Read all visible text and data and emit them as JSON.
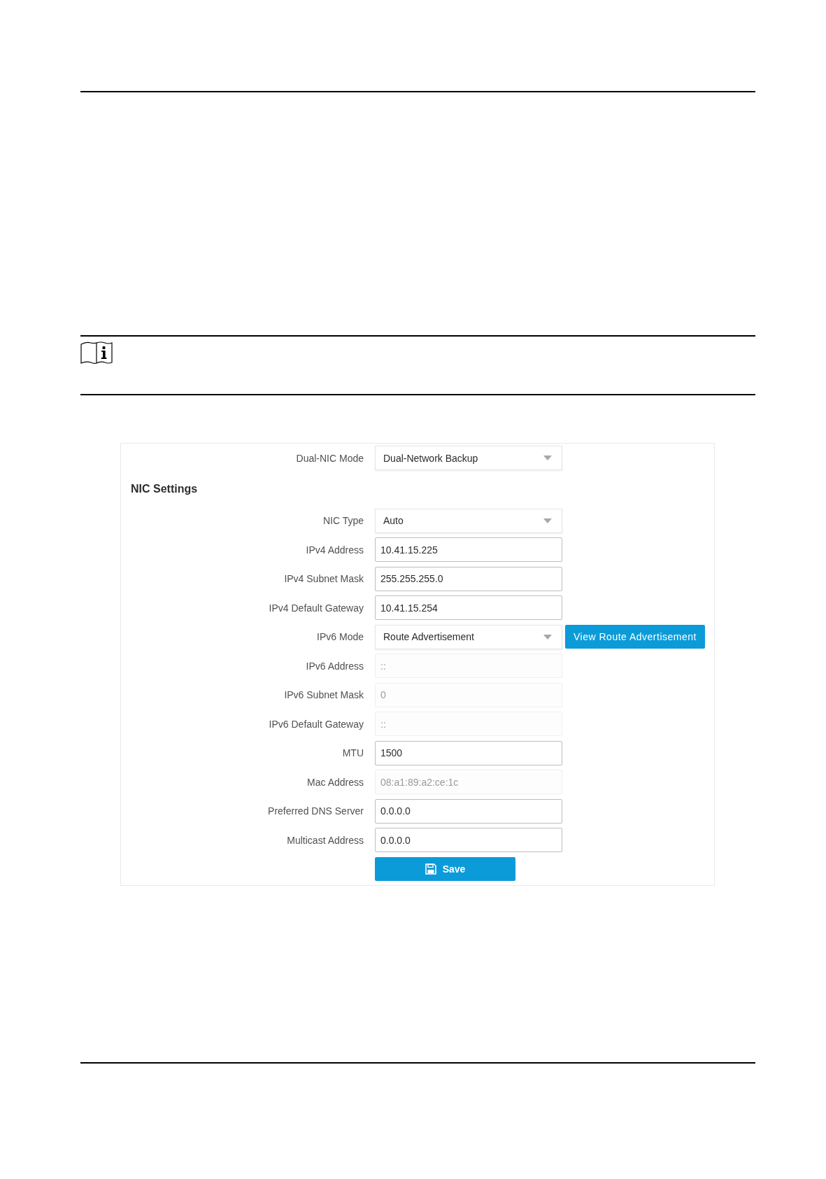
{
  "network_settings": {
    "mode_field": {
      "label": "Dual-NIC Mode",
      "kind": "select",
      "value": "Dual-Network Backup",
      "disabled": false
    },
    "section_title": "NIC Settings",
    "fields": [
      {
        "label": "NIC Type",
        "kind": "select",
        "value": "Auto",
        "disabled": false
      },
      {
        "label": "IPv4 Address",
        "kind": "text",
        "value": "10.41.15.225",
        "disabled": false
      },
      {
        "label": "IPv4 Subnet Mask",
        "kind": "text",
        "value": "255.255.255.0",
        "disabled": false
      },
      {
        "label": "IPv4 Default Gateway",
        "kind": "text",
        "value": "10.41.15.254",
        "disabled": false
      },
      {
        "label": "IPv6 Mode",
        "kind": "select",
        "value": "Route Advertisement",
        "disabled": false,
        "action": "View Route Advertisement"
      },
      {
        "label": "IPv6 Address",
        "kind": "text",
        "value": "::",
        "disabled": true
      },
      {
        "label": "IPv6 Subnet Mask",
        "kind": "text",
        "value": "0",
        "disabled": true
      },
      {
        "label": "IPv6 Default Gateway",
        "kind": "text",
        "value": "::",
        "disabled": true
      },
      {
        "label": "MTU",
        "kind": "text",
        "value": "1500",
        "disabled": false
      },
      {
        "label": "Mac Address",
        "kind": "text",
        "value": "08:a1:89:a2:ce:1c",
        "disabled": true
      },
      {
        "label": "Preferred DNS Server",
        "kind": "text",
        "value": "0.0.0.0",
        "disabled": false
      },
      {
        "label": "Multicast Address",
        "kind": "text",
        "value": "0.0.0.0",
        "disabled": false
      }
    ],
    "save_button": "Save"
  }
}
